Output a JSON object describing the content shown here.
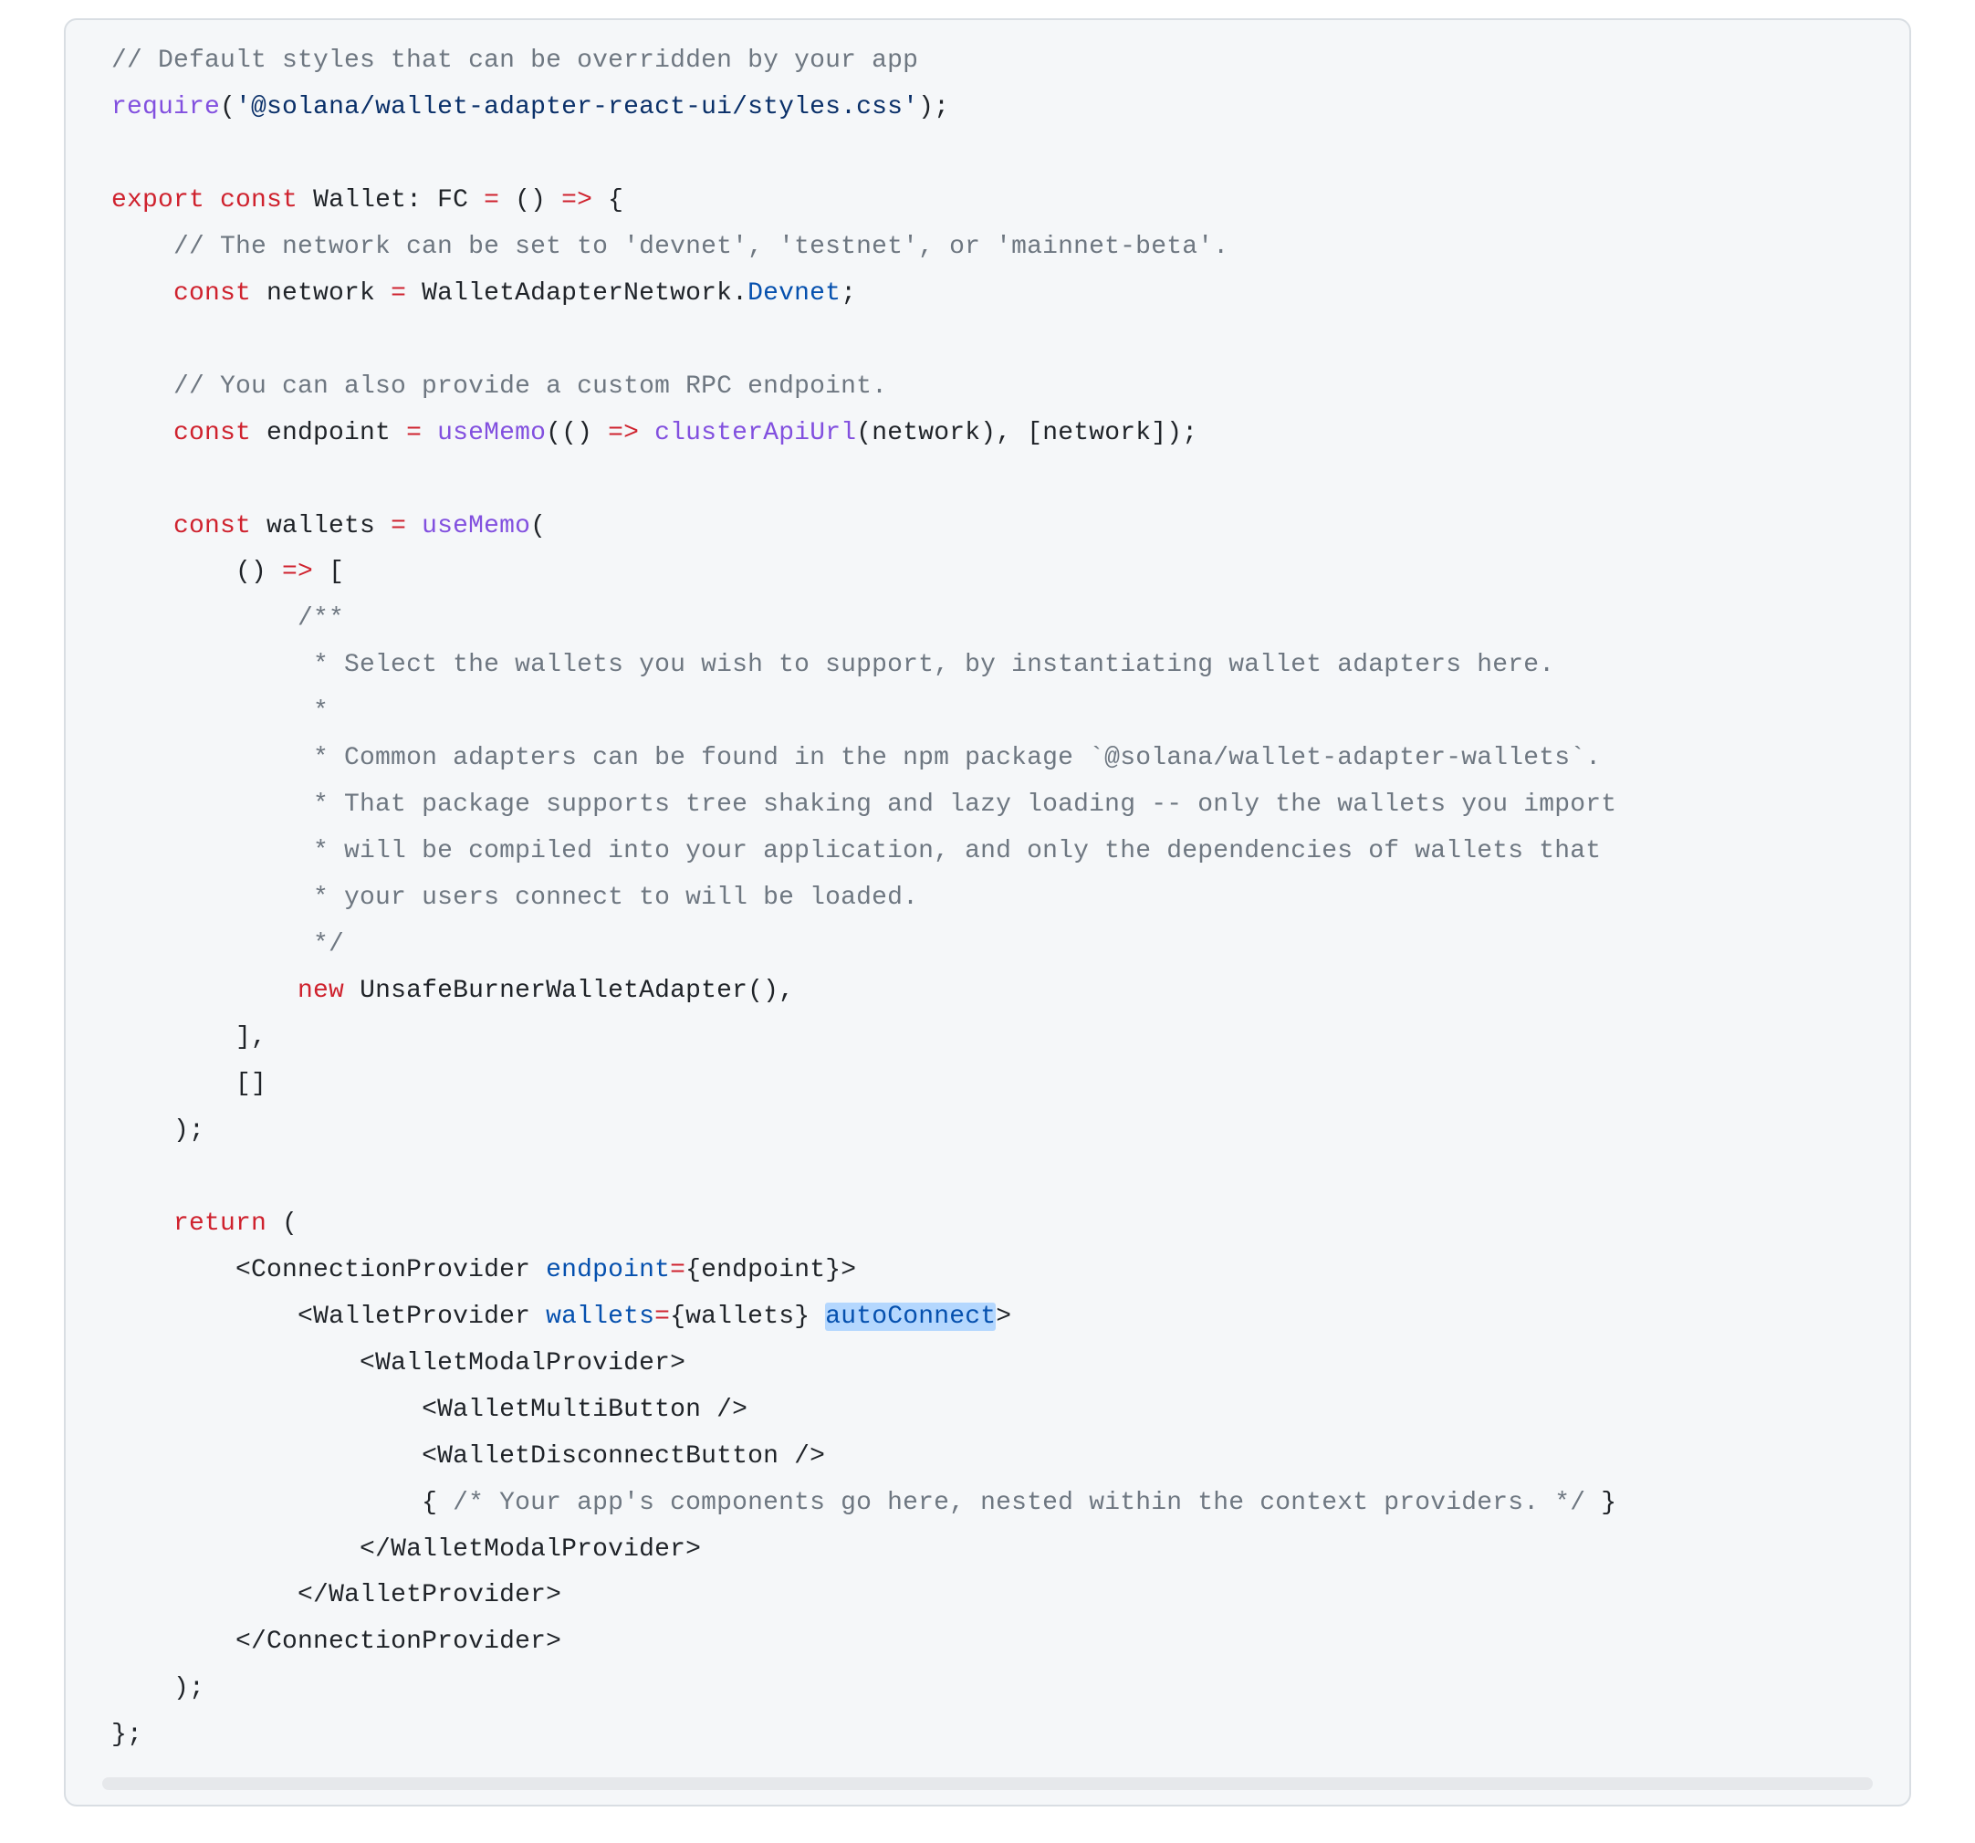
{
  "code": {
    "l01_comment": "// Default styles that can be overridden by your app",
    "l02a": "require",
    "l02b": "(",
    "l02c": "'@solana/wallet-adapter-react-ui/styles.css'",
    "l02d": ");",
    "l03_blank": "",
    "l04a": "export",
    "l04b": " ",
    "l04c": "const",
    "l04d": " Wallet",
    "l04e": ":",
    "l04f": " FC ",
    "l04g": "=",
    "l04h": " () ",
    "l04i": "=>",
    "l04j": " {",
    "l05_indent": "    ",
    "l05_comment": "// The network can be set to 'devnet', 'testnet', or 'mainnet-beta'.",
    "l06_indent": "    ",
    "l06a": "const",
    "l06b": " network ",
    "l06c": "=",
    "l06d": " WalletAdapterNetwork",
    "l06e": ".",
    "l06f": "Devnet",
    "l06g": ";",
    "l07_blank": "",
    "l08_indent": "    ",
    "l08_comment": "// You can also provide a custom RPC endpoint.",
    "l09_indent": "    ",
    "l09a": "const",
    "l09b": " endpoint ",
    "l09c": "=",
    "l09d": " ",
    "l09e": "useMemo",
    "l09f": "(() ",
    "l09g": "=>",
    "l09h": " ",
    "l09i": "clusterApiUrl",
    "l09j": "(network), [network]);",
    "l10_blank": "",
    "l11_indent": "    ",
    "l11a": "const",
    "l11b": " wallets ",
    "l11c": "=",
    "l11d": " ",
    "l11e": "useMemo",
    "l11f": "(",
    "l12_indent": "        ",
    "l12a": "() ",
    "l12b": "=>",
    "l12c": " [",
    "l13_indent": "            ",
    "l13a": "/**",
    "l14_indent": "             ",
    "l14a": "* Select the wallets you wish to support, by instantiating wallet adapters here.",
    "l15_indent": "             ",
    "l15a": "*",
    "l16_indent": "             ",
    "l16a": "* Common adapters can be found in the npm package `@solana/wallet-adapter-wallets`.",
    "l17_indent": "             ",
    "l17a": "* That package supports tree shaking and lazy loading -- only the wallets you import",
    "l18_indent": "             ",
    "l18a": "* will be compiled into your application, and only the dependencies of wallets that",
    "l19_indent": "             ",
    "l19a": "* your users connect to will be loaded.",
    "l20_indent": "             ",
    "l20a": "*/",
    "l21_indent": "            ",
    "l21a": "new",
    "l21b": " ",
    "l21c": "UnsafeBurnerWalletAdapter",
    "l21d": "(),",
    "l22_indent": "        ",
    "l22a": "],",
    "l23_indent": "        ",
    "l23a": "[]",
    "l24_indent": "    ",
    "l24a": ");",
    "l25_blank": "",
    "l26_indent": "    ",
    "l26a": "return",
    "l26b": " (",
    "l27_indent": "        ",
    "l27a": "<",
    "l27b": "ConnectionProvider",
    "l27c": " ",
    "l27d": "endpoint",
    "l27e": "=",
    "l27f": "{endpoint}",
    "l27g": ">",
    "l28_indent": "            ",
    "l28a": "<",
    "l28b": "WalletProvider",
    "l28c": " ",
    "l28d": "wallets",
    "l28e": "=",
    "l28f": "{wallets}",
    "l28g": " ",
    "l28h": "autoConnect",
    "l28i": ">",
    "l29_indent": "                ",
    "l29a": "<",
    "l29b": "WalletModalProvider",
    "l29c": ">",
    "l30_indent": "                    ",
    "l30a": "<",
    "l30b": "WalletMultiButton",
    "l30c": " ",
    "l30d": "/>",
    "l31_indent": "                    ",
    "l31a": "<",
    "l31b": "WalletDisconnectButton",
    "l31c": " ",
    "l31d": "/>",
    "l32_indent": "                    ",
    "l32a": "{ ",
    "l32b": "/* Your app's components go here, nested within the context providers. */",
    "l32c": " }",
    "l33_indent": "                ",
    "l33a": "</",
    "l33b": "WalletModalProvider",
    "l33c": ">",
    "l34_indent": "            ",
    "l34a": "</",
    "l34b": "WalletProvider",
    "l34c": ">",
    "l35_indent": "        ",
    "l35a": "</",
    "l35b": "ConnectionProvider",
    "l35c": ">",
    "l36_indent": "    ",
    "l36a": ");",
    "l37a": "};"
  }
}
